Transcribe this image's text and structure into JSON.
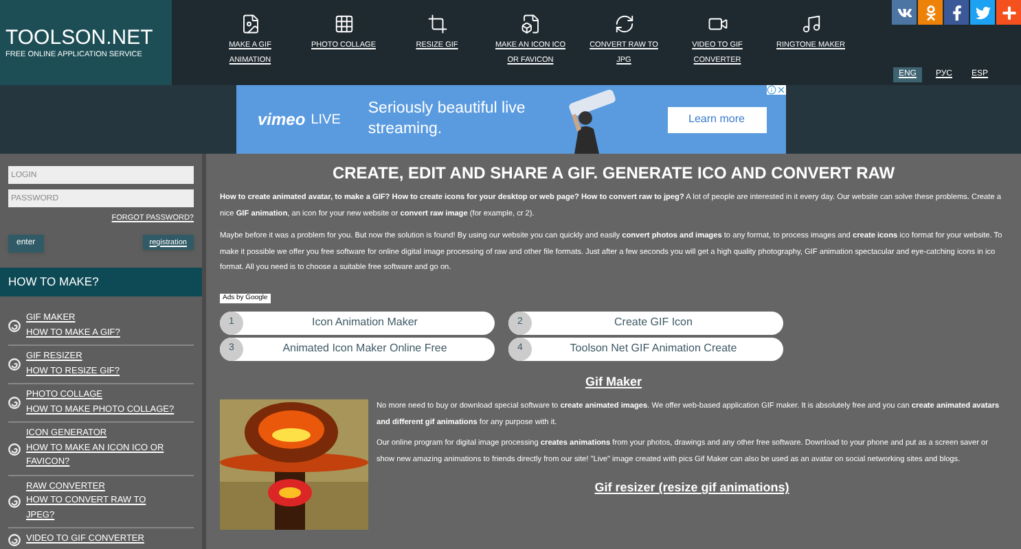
{
  "logo": {
    "title": "TOOLSON.NET",
    "tagline": "FREE ONLINE APPLICATION SERVICE"
  },
  "nav": [
    {
      "label": "MAKE A GIF ANIMATION",
      "kind": "gif"
    },
    {
      "label": "PHOTO COLLAGE",
      "kind": "collage"
    },
    {
      "label": "RESIZE GIF",
      "kind": "resize"
    },
    {
      "label": "MAKE AN ICON ICO OR FAVICON",
      "kind": "ico"
    },
    {
      "label": "CONVERT RAW TO JPG",
      "kind": "raw"
    },
    {
      "label": "VIDEO TO GIF CONVERTER",
      "kind": "video"
    },
    {
      "label": "RINGTONE MAKER",
      "kind": "music"
    }
  ],
  "social": [
    {
      "kind": "vk",
      "color": "#4c75a3"
    },
    {
      "kind": "ok",
      "color": "#ee8208"
    },
    {
      "kind": "facebook",
      "color": "#3b5998"
    },
    {
      "kind": "twitter",
      "color": "#1da1f2"
    },
    {
      "kind": "plus",
      "color": "#f4511e"
    }
  ],
  "languages": [
    {
      "label": "ENG",
      "selected": true
    },
    {
      "label": "РУС",
      "selected": false
    },
    {
      "label": "ESP",
      "selected": false
    }
  ],
  "ad_banner": {
    "brand": "vimeo",
    "live": "LIVE",
    "headline": "Seriously beautiful live streaming.",
    "button": "Learn more"
  },
  "login": {
    "login_placeholder": "LOGIN",
    "password_placeholder": "PASSWORD",
    "forgot": "FORGOT PASSWORD?",
    "enter": "enter",
    "register": "registration"
  },
  "sidebar": {
    "title": "HOW TO MAKE?",
    "items": [
      {
        "name": "GIF MAKER",
        "question": "HOW TO MAKE A GIF?"
      },
      {
        "name": "GIF RESIZER",
        "question": "HOW TO RESIZE GIF?"
      },
      {
        "name": "PHOTO COLLAGE",
        "question": "HOW TO MAKE PHOTO COLLAGE?"
      },
      {
        "name": "ICON GENERATOR",
        "question": "HOW TO MAKE AN ICON ICO OR FAVICON?"
      },
      {
        "name": "RAW CONVERTER",
        "question": "HOW TO CONVERT RAW TO JPEG?"
      },
      {
        "name": "VIDEO TO GIF CONVERTER"
      }
    ]
  },
  "main": {
    "heading": "CREATE, EDIT AND SHARE A GIF. GENERATE ICO AND CONVERT RAW",
    "intro": [
      "**How to create animated avatar, to make a GIF? How to create icons for your desktop or web page? How to convert raw to jpeg?** A lot of people are interested in it every day. Our website can solve these problems. Create a nice **GIF animation**, an icon for your new website or **convert raw image** (for example, cr 2).",
      "Maybe before it was a problem for you. But now the solution is found! By using our website you can quickly and easily **convert photos and images** to any format, to process images and **create icons** ico format for your website. To make it possible we offer you free software for online digital image processing of raw and other file formats. Just after a few seconds you will get a high quality photography, GIF animation spectacular and eye-catching icons in ico format. All you need is to choose a suitable free software and go on."
    ],
    "ads_label": "Ads by Google",
    "ad_links": [
      {
        "number": "1",
        "text": "Icon Animation Maker"
      },
      {
        "number": "2",
        "text": "Create GIF Icon"
      },
      {
        "number": "3",
        "text": "Animated Icon Maker Online Free"
      },
      {
        "number": "4",
        "text": "Toolson Net GIF Animation Create"
      }
    ],
    "section_title": "Gif Maker",
    "section_text": [
      "No more need to buy or download special software to **create animated images**. We offer web-based application GIF maker. It is absolutely free and you can **create animated avatars and different gif animations** for any purpose with it.",
      "Our online program for digital image processing **creates animations** from your photos, drawings and any other free software. Download to your phone and put as a screen saver or show new amazing animations to friends directly from our site! \"Live\" image created with pics Gif Maker can also be used as an avatar on social networking sites and blogs."
    ],
    "next_section_title": "Gif resizer (resize gif animations)"
  }
}
